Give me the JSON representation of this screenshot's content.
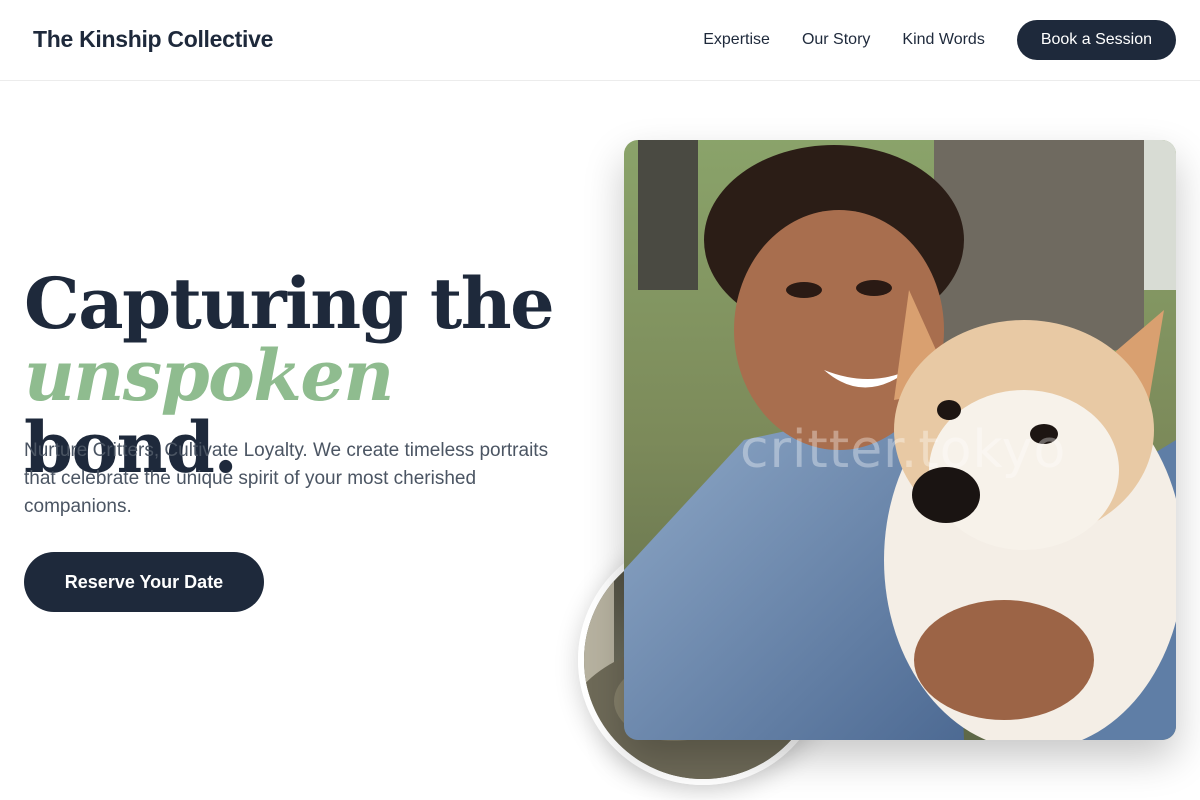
{
  "header": {
    "brand": "The Kinship Collective",
    "nav": [
      "Expertise",
      "Our Story",
      "Kind Words"
    ],
    "cta_label": "Book a Session"
  },
  "hero": {
    "headline_line1": "Capturing the",
    "headline_accent": "unspoken",
    "headline_end": " bond.",
    "subtext": "Nurture Critters, Cultivate Loyalty. We create timeless portraits that celebrate the unique spirit of your most cherished companions.",
    "cta_label": "Reserve Your Date"
  },
  "photo": {
    "watermark": "critter.tokyo"
  },
  "colors": {
    "navy": "#1e293b",
    "sage": "#8fbc8f",
    "body_text": "#4b5563"
  }
}
